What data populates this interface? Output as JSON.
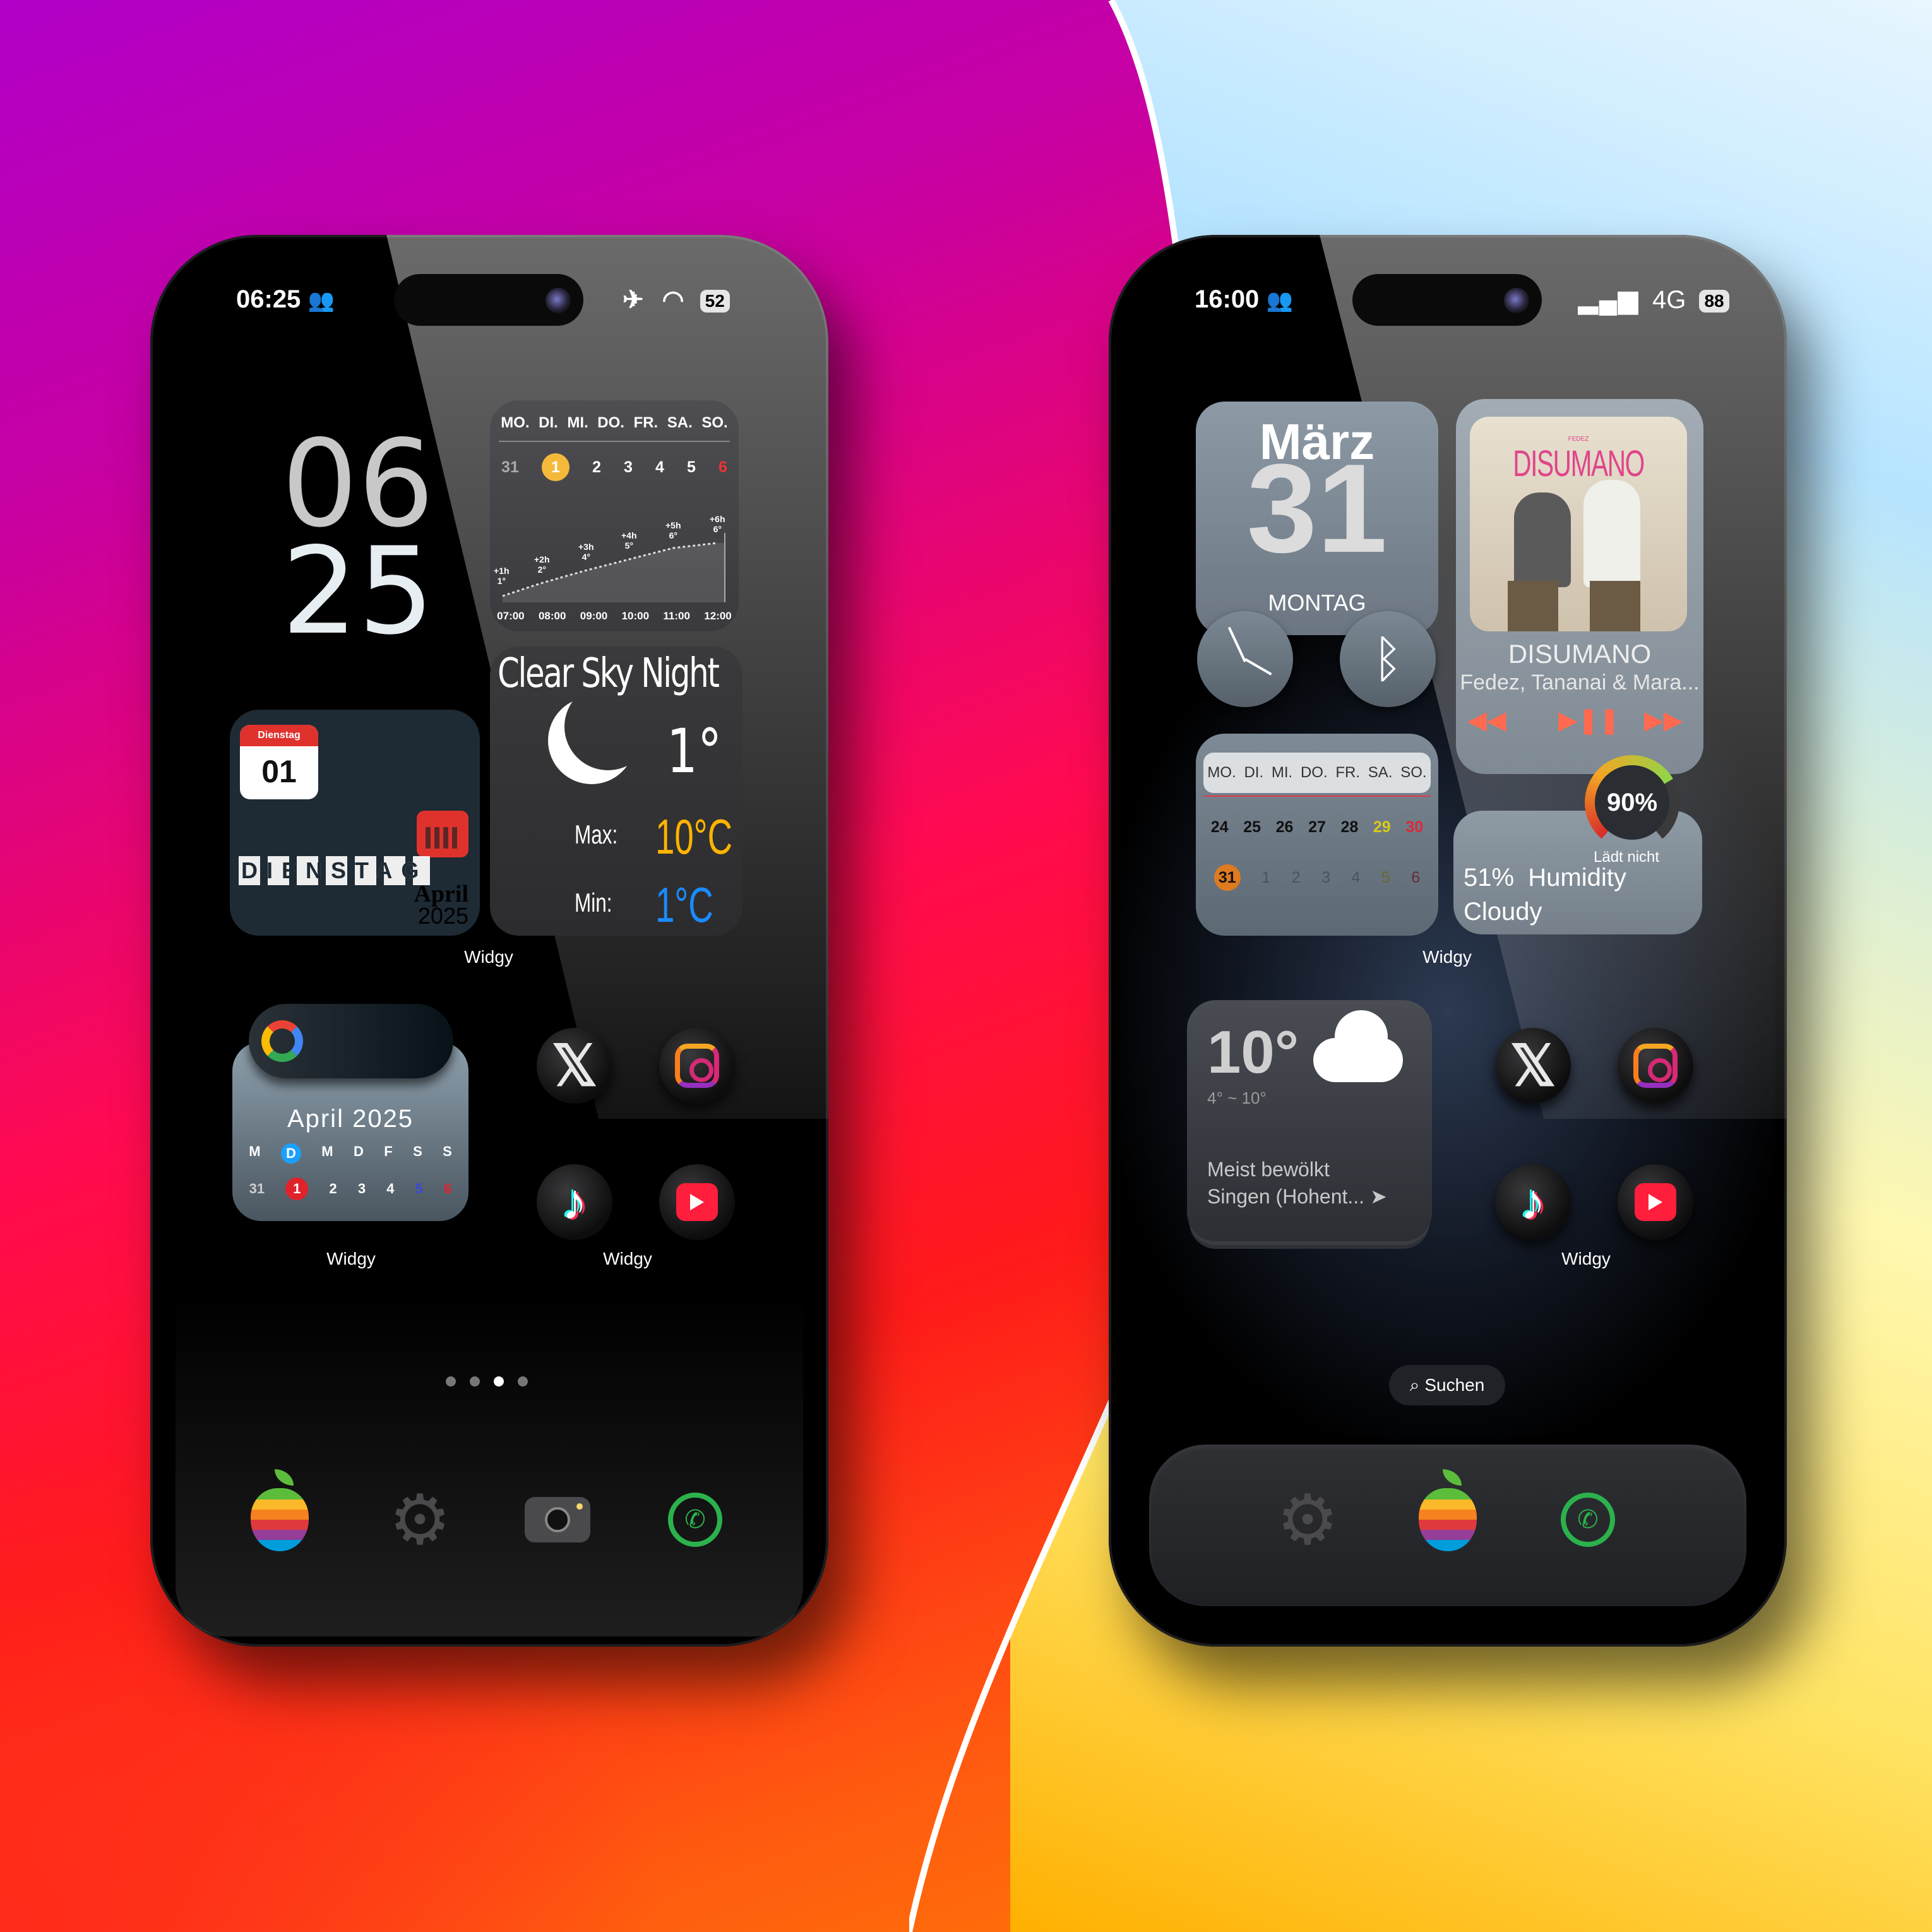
{
  "left_phone": {
    "status": {
      "time": "06:25",
      "battery": "52"
    },
    "clock": {
      "hour": "06",
      "minute": "25"
    },
    "forecast": {
      "days": [
        "MO.",
        "DI.",
        "MI.",
        "DO.",
        "FR.",
        "SA.",
        "SO."
      ],
      "dates": [
        "31",
        "1",
        "2",
        "3",
        "4",
        "5",
        "6"
      ],
      "points": [
        {
          "offset": "+1h",
          "temp": "1°"
        },
        {
          "offset": "+2h",
          "temp": "2°"
        },
        {
          "offset": "+3h",
          "temp": "4°"
        },
        {
          "offset": "+4h",
          "temp": "5°"
        },
        {
          "offset": "+5h",
          "temp": "6°"
        },
        {
          "offset": "+6h",
          "temp": "6°"
        }
      ],
      "times": [
        "07:00",
        "08:00",
        "09:00",
        "10:00",
        "11:00",
        "12:00"
      ]
    },
    "weather": {
      "title": "Clear Sky Night",
      "temp": "1°",
      "max_label": "Max:",
      "max_value": "10°C",
      "min_label": "Min:",
      "min_value": "1°C"
    },
    "date_widget": {
      "tag": "Dienstag",
      "day": "01",
      "weekday": "DIENSTAG",
      "month": "April",
      "year": "2025"
    },
    "widget_label": "Widgy",
    "month_cal": {
      "title": "April 2025",
      "days": [
        "M",
        "D",
        "M",
        "D",
        "F",
        "S",
        "S"
      ],
      "dates": [
        "31",
        "1",
        "2",
        "3",
        "4",
        "5",
        "6"
      ]
    },
    "label_cal": "Widgy",
    "label_apps": "Widgy",
    "pages": 4,
    "active_page": 2
  },
  "right_phone": {
    "status": {
      "time": "16:00",
      "network": "4G",
      "battery": "88"
    },
    "date_widget": {
      "month": "März",
      "day": "31",
      "weekday": "MONTAG"
    },
    "music": {
      "cover_text": "DISUMANO",
      "cover_artist": "FEDEZ",
      "title": "DISUMANO",
      "artist": "Fedez, Tananai & Mara..."
    },
    "week_cal": {
      "days": [
        "MO.",
        "DI.",
        "MI.",
        "DO.",
        "FR.",
        "SA.",
        "SO."
      ],
      "row1": [
        "24",
        "25",
        "26",
        "27",
        "28",
        "29",
        "30"
      ],
      "row2": [
        "31",
        "1",
        "2",
        "3",
        "4",
        "5",
        "6"
      ]
    },
    "battery_gauge": {
      "value": "90%",
      "status": "Lädt nicht"
    },
    "humidity": {
      "line1": "51%  Humidity",
      "line2": "Cloudy"
    },
    "widget_label": "Widgy",
    "weather": {
      "temp": "10°",
      "range": "4° ~ 10°",
      "desc": "Meist bewölkt",
      "location": "Singen (Hohent..."
    },
    "label_apps": "Widgy",
    "search": "Suchen"
  },
  "colors": {
    "accent_orange": "#ffb400",
    "accent_blue": "#1a8cff",
    "today_yellow": "#f5b93a"
  }
}
